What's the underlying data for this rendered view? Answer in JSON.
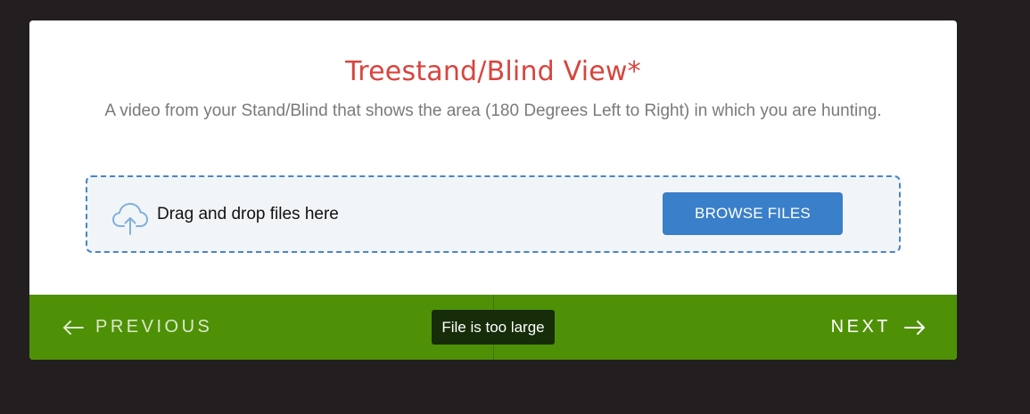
{
  "card": {
    "title": "Treestand/Blind View*",
    "description": "A video from your Stand/Blind that shows the area (180 Degrees Left to Right) in which you are hunting."
  },
  "dropzone": {
    "icon": "cloud-upload-icon",
    "label": "Drag and drop files here",
    "browse_label": "BROWSE FILES"
  },
  "footer": {
    "previous_label": "PREVIOUS",
    "next_label": "NEXT",
    "previous_icon": "arrow-left-icon",
    "next_icon": "arrow-right-icon",
    "tooltip": "File is too large"
  },
  "colors": {
    "background": "#231f20",
    "title": "#d9443d",
    "accent": "#3a7fc9",
    "footer": "#4e9106",
    "tooltip": "#172d0a"
  }
}
